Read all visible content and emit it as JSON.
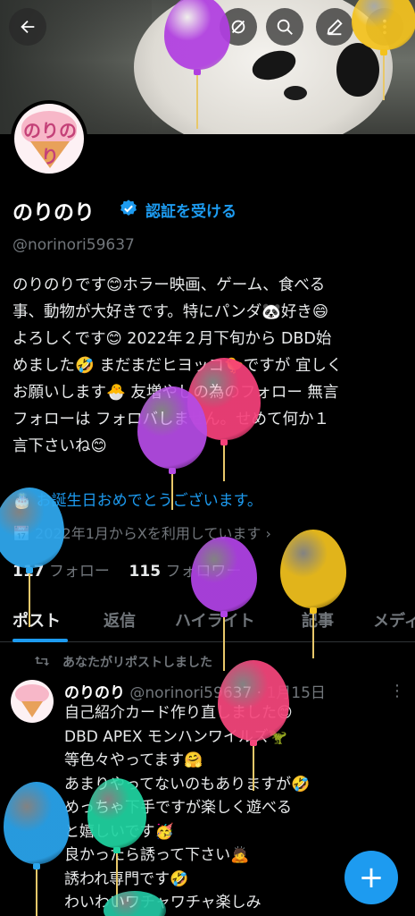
{
  "header": {
    "back_icon": "arrow-left-icon",
    "actions": [
      "bell-off-icon",
      "search-icon",
      "edit-icon",
      "more-vertical-icon"
    ]
  },
  "profile": {
    "avatar_text": "のりのり",
    "name": "のりのり",
    "verified_icon": "verified-badge-icon",
    "verify_link": "認証を受ける",
    "handle": "@norinori59637",
    "bio_lines": [
      "のりのりです😊ホラー映画、ゲーム、食べる",
      "事、動物が大好きです。特にパンダ🐼好き😄",
      "よろしくです😊 2022年２月下旬から DBD始",
      "めました🤣 まだまだヒヨッコ🐤ですが 宜しく",
      "お願いします🐣 友増やしの為のフォロー 無言",
      "フォローは フォロバしません。せめて何か１",
      "言下さいね😊"
    ],
    "birthday": "🎂 お誕生日おめでとうございます。",
    "joined": "📅 2022年1月からXを利用しています ›",
    "following_count": "117",
    "following_label": "フォロー",
    "followers_count": "115",
    "followers_label": "フォロワー"
  },
  "tabs": [
    "ポスト",
    "返信",
    "ハイライト",
    "記事",
    "メディ"
  ],
  "post": {
    "repost_text": "あなたがリポストしました",
    "author_name": "のりのり",
    "author_meta": "@norinori59637 · 1月15日",
    "body_lines": [
      "自己紹介カード作り直しました😊",
      "DBD APEX モンハンワイルズ🦖",
      "等色々やってます🤗",
      "あまりやってないのもありますが🤣",
      "めっちゃ下手ですが楽しく遊べる",
      "と嬉しいです🥳",
      "良かったら誘って下さい🙇",
      "誘われ専門です🤣",
      "わいわいワチャワチャ楽しみ"
    ]
  },
  "fab": "+",
  "colors": {
    "accent": "#1d9bf0",
    "balloons": [
      "#b03ee0",
      "#f3c21e",
      "#f5407a",
      "#b54be5",
      "#2fa9f0",
      "#b143e6",
      "#f2c21d",
      "#f5467c",
      "#2aa5ee",
      "#1fd3a0",
      "#22c7a3"
    ]
  }
}
